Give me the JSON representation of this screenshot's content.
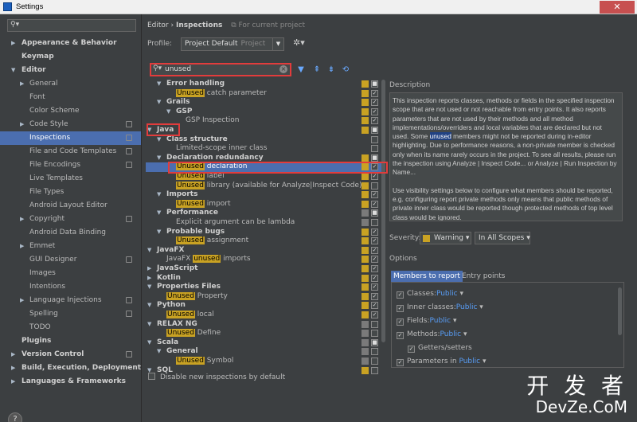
{
  "window": {
    "title": "Settings",
    "close_glyph": "✕"
  },
  "left_tree": [
    {
      "label": "Appearance & Behavior",
      "level": 0,
      "bold": true,
      "arrow": "▶"
    },
    {
      "label": "Keymap",
      "level": 0,
      "bold": true,
      "arrow": ""
    },
    {
      "label": "Editor",
      "level": 0,
      "bold": true,
      "arrow": "▼"
    },
    {
      "label": "General",
      "level": 1,
      "arrow": "▶"
    },
    {
      "label": "Font",
      "level": 1,
      "arrow": ""
    },
    {
      "label": "Color Scheme",
      "level": 1,
      "arrow": ""
    },
    {
      "label": "Code Style",
      "level": 1,
      "arrow": "▶",
      "proj": true
    },
    {
      "label": "Inspections",
      "level": 1,
      "arrow": "",
      "selected": true,
      "proj": true
    },
    {
      "label": "File and Code Templates",
      "level": 1,
      "arrow": "",
      "proj": true
    },
    {
      "label": "File Encodings",
      "level": 1,
      "arrow": "",
      "proj": true
    },
    {
      "label": "Live Templates",
      "level": 1,
      "arrow": ""
    },
    {
      "label": "File Types",
      "level": 1,
      "arrow": ""
    },
    {
      "label": "Android Layout Editor",
      "level": 1,
      "arrow": ""
    },
    {
      "label": "Copyright",
      "level": 1,
      "arrow": "▶",
      "proj": true
    },
    {
      "label": "Android Data Binding",
      "level": 1,
      "arrow": ""
    },
    {
      "label": "Emmet",
      "level": 1,
      "arrow": "▶"
    },
    {
      "label": "GUI Designer",
      "level": 1,
      "arrow": "",
      "proj": true
    },
    {
      "label": "Images",
      "level": 1,
      "arrow": ""
    },
    {
      "label": "Intentions",
      "level": 1,
      "arrow": ""
    },
    {
      "label": "Language Injections",
      "level": 1,
      "arrow": "▶",
      "proj": true
    },
    {
      "label": "Spelling",
      "level": 1,
      "arrow": "",
      "proj": true
    },
    {
      "label": "TODO",
      "level": 1,
      "arrow": ""
    },
    {
      "label": "Plugins",
      "level": 0,
      "bold": true,
      "arrow": ""
    },
    {
      "label": "Version Control",
      "level": 0,
      "bold": true,
      "arrow": "▶",
      "proj": true
    },
    {
      "label": "Build, Execution, Deployment",
      "level": 0,
      "bold": true,
      "arrow": "▶"
    },
    {
      "label": "Languages & Frameworks",
      "level": 0,
      "bold": true,
      "arrow": "▶"
    }
  ],
  "breadcrumb": {
    "parent": "Editor",
    "sep": "›",
    "current": "Inspections",
    "note": "For current project"
  },
  "profile": {
    "label": "Profile:",
    "value": "Project Default",
    "scope": "Project"
  },
  "search": {
    "value": "unused"
  },
  "inspections": [
    {
      "level": 1,
      "arrow": "▼",
      "bold": true,
      "pre": "",
      "hl": "",
      "post": "Error handling",
      "sev": "#c9a223",
      "check": "■"
    },
    {
      "level": 2,
      "arrow": "",
      "pre": "",
      "hl": "Unused",
      "post": " catch parameter",
      "sev": "#c9a223",
      "check": "✓"
    },
    {
      "level": 1,
      "arrow": "▼",
      "bold": true,
      "pre": "",
      "hl": "",
      "post": "Grails",
      "sev": "#c9a223",
      "check": "✓"
    },
    {
      "level": 2,
      "arrow": "▼",
      "bold": true,
      "pre": "",
      "hl": "",
      "post": "GSP",
      "sev": "#c9a223",
      "check": "✓"
    },
    {
      "level": 3,
      "arrow": "",
      "pre": "GSP Inspection",
      "hl": "",
      "post": "",
      "sev": "#c9a223",
      "check": "✓"
    },
    {
      "level": 0,
      "arrow": "▼",
      "bold": true,
      "pre": "",
      "hl": "",
      "post": "Java",
      "sev": "#c9a223",
      "check": "■"
    },
    {
      "level": 1,
      "arrow": "▼",
      "bold": true,
      "pre": "",
      "hl": "",
      "post": "Class structure",
      "sev": "",
      "check": ""
    },
    {
      "level": 2,
      "arrow": "",
      "pre": "Limited-scope inner class",
      "hl": "",
      "post": "",
      "sev": "",
      "check": ""
    },
    {
      "level": 1,
      "arrow": "▼",
      "bold": true,
      "pre": "",
      "hl": "",
      "post": "Declaration redundancy",
      "sev": "#c9a223",
      "check": "■"
    },
    {
      "level": 2,
      "arrow": "",
      "pre": "",
      "hl": "Unused",
      "post": " declaration",
      "sev": "#c9a223",
      "check": "✓",
      "selected": true
    },
    {
      "level": 2,
      "arrow": "",
      "pre": "",
      "hl": "Unused",
      "post": " label",
      "sev": "#c9a223",
      "check": "✓"
    },
    {
      "level": 2,
      "arrow": "",
      "pre": "",
      "hl": "Unused",
      "post": " library (available for Analyze|Inspect Code)",
      "sev": "#c9a223",
      "check": ""
    },
    {
      "level": 1,
      "arrow": "▼",
      "bold": true,
      "pre": "",
      "hl": "",
      "post": "Imports",
      "sev": "#c9a223",
      "check": "✓"
    },
    {
      "level": 2,
      "arrow": "",
      "pre": "",
      "hl": "Unused",
      "post": " import",
      "sev": "#c9a223",
      "check": "✓"
    },
    {
      "level": 1,
      "arrow": "▼",
      "bold": true,
      "pre": "",
      "hl": "",
      "post": "Performance",
      "sev": "#7a7a7a",
      "check": "■"
    },
    {
      "level": 2,
      "arrow": "",
      "pre": "Explicit argument can be lambda",
      "hl": "",
      "post": "",
      "sev": "#7a7a7a",
      "check": ""
    },
    {
      "level": 1,
      "arrow": "▼",
      "bold": true,
      "pre": "",
      "hl": "",
      "post": "Probable bugs",
      "sev": "#c9a223",
      "check": "✓"
    },
    {
      "level": 2,
      "arrow": "",
      "pre": "",
      "hl": "Unused",
      "post": " assignment",
      "sev": "#c9a223",
      "check": "✓"
    },
    {
      "level": 0,
      "arrow": "▼",
      "bold": true,
      "pre": "",
      "hl": "",
      "post": "JavaFX",
      "sev": "#c9a223",
      "check": "✓"
    },
    {
      "level": 1,
      "arrow": "",
      "pre": "JavaFX ",
      "hl": "unused",
      "post": " imports",
      "sev": "#c9a223",
      "check": "✓"
    },
    {
      "level": 0,
      "arrow": "▶",
      "bold": true,
      "pre": "",
      "hl": "",
      "post": "JavaScript",
      "sev": "#c9a223",
      "check": "✓"
    },
    {
      "level": 0,
      "arrow": "▶",
      "bold": true,
      "pre": "",
      "hl": "",
      "post": "Kotlin",
      "sev": "#c9a223",
      "check": "✓"
    },
    {
      "level": 0,
      "arrow": "▼",
      "bold": true,
      "pre": "",
      "hl": "",
      "post": "Properties Files",
      "sev": "#c9a223",
      "check": "✓"
    },
    {
      "level": 1,
      "arrow": "",
      "pre": "",
      "hl": "Unused",
      "post": " Property",
      "sev": "#c9a223",
      "check": "✓"
    },
    {
      "level": 0,
      "arrow": "▼",
      "bold": true,
      "pre": "",
      "hl": "",
      "post": "Python",
      "sev": "#c9a223",
      "check": "✓"
    },
    {
      "level": 1,
      "arrow": "",
      "pre": "",
      "hl": "Unused",
      "post": " local",
      "sev": "#c9a223",
      "check": "✓"
    },
    {
      "level": 0,
      "arrow": "▼",
      "bold": true,
      "pre": "",
      "hl": "",
      "post": "RELAX NG",
      "sev": "#7a7a7a",
      "check": ""
    },
    {
      "level": 1,
      "arrow": "",
      "pre": "",
      "hl": "Unused",
      "post": " Define",
      "sev": "#7a7a7a",
      "check": ""
    },
    {
      "level": 0,
      "arrow": "▼",
      "bold": true,
      "pre": "",
      "hl": "",
      "post": "Scala",
      "sev": "#7a7a7a",
      "check": "■"
    },
    {
      "level": 1,
      "arrow": "▼",
      "bold": true,
      "pre": "",
      "hl": "",
      "post": "General",
      "sev": "#7a7a7a",
      "check": ""
    },
    {
      "level": 2,
      "arrow": "",
      "pre": "",
      "hl": "Unused",
      "post": " Symbol",
      "sev": "#7a7a7a",
      "check": ""
    },
    {
      "level": 0,
      "arrow": "▼",
      "bold": true,
      "pre": "",
      "hl": "",
      "post": "SQL",
      "sev": "#c9a223",
      "check": ""
    }
  ],
  "description": {
    "label": "Description",
    "p1_before": "This inspection reports classes, methods or fields in the specified inspection scope that are not used or not reachable from entry points. It also reports parameters that are not used by their methods and all method implementations/overriders and local variables that are declared but not used. Some ",
    "p1_kw": "unused",
    "p1_after": " members might not be reported during in-editor highlighting. Due to performance reasons, a non-private member is checked only when its name rarely occurs in the project. To see all results, please run the inspection using Analyze | Inspect Code... or Analyze | Run Inspection by Name...",
    "p2": "Use visibility settings below to configure what members should be reported, e.g. configuring report private methods only means that public methods of private inner class would be reported though protected methods of top level class would be ignored."
  },
  "severity": {
    "label": "Severity:",
    "value": "Warning",
    "color": "#c9a223",
    "scope": "In All Scopes"
  },
  "options": {
    "label": "Options",
    "tabs": [
      "Members to report",
      "Entry points"
    ],
    "rows": [
      {
        "label": "Classes:",
        "link": "Public",
        "indent": 0
      },
      {
        "label": "Inner classes:",
        "link": "Public",
        "indent": 0
      },
      {
        "label": "Fields:",
        "link": "Public",
        "indent": 0
      },
      {
        "label": "Methods:",
        "link": "Public",
        "indent": 0
      },
      {
        "label": "Getters/setters",
        "link": "",
        "indent": 1
      },
      {
        "label": "Parameters in ",
        "link": "Public",
        "indent": 0
      }
    ]
  },
  "disable_new": "Disable new inspections by default",
  "help": "?",
  "watermark": {
    "cn": "开 发 者",
    "en": "DevZe.CoM",
    "url": "https://b"
  }
}
